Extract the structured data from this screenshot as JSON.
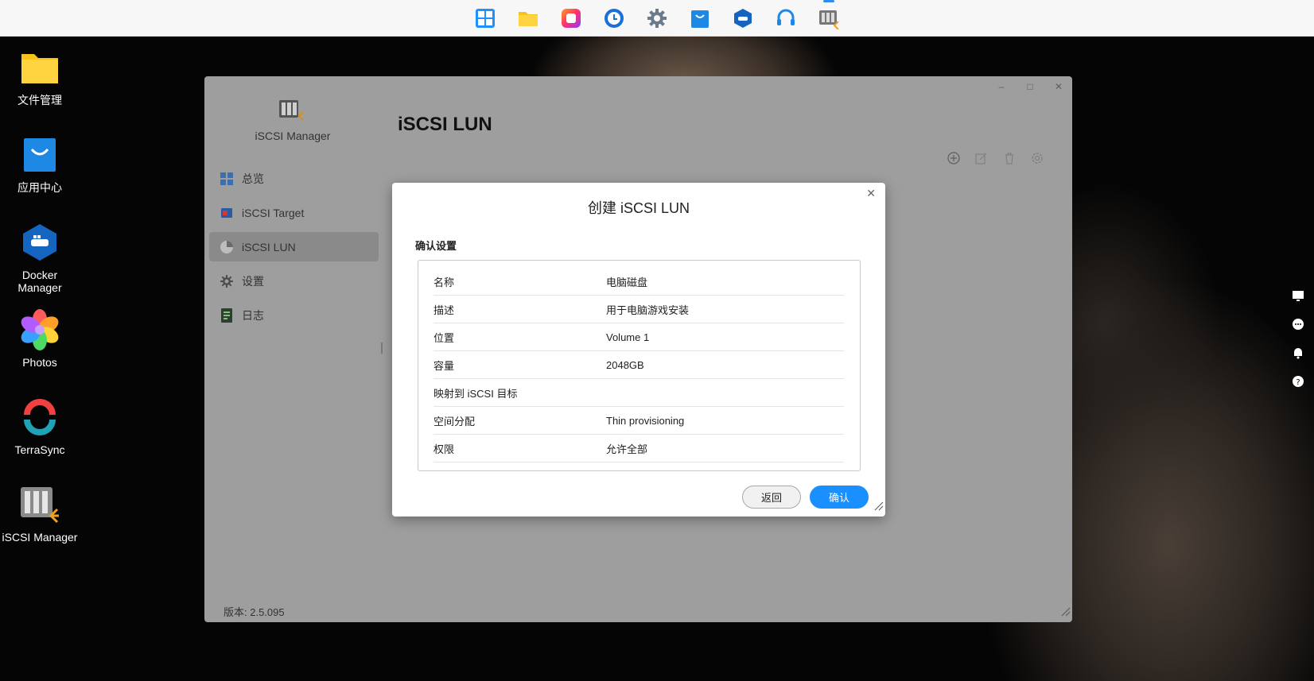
{
  "taskbar": {
    "icons": [
      "apps-grid-icon",
      "file-manager-icon",
      "photos-square-icon",
      "clock-icon",
      "settings-gear-icon",
      "app-store-bag-icon",
      "docker-icon",
      "headset-icon",
      "iscsi-manager-icon"
    ]
  },
  "desktop": {
    "items": [
      {
        "label": "文件管理",
        "icon": "folder-icon"
      },
      {
        "label": "应用中心",
        "icon": "shopping-bag-icon"
      },
      {
        "label": "Docker\nManager",
        "label1": "Docker",
        "label2": "Manager",
        "icon": "docker-icon"
      },
      {
        "label": "Photos",
        "icon": "flower-icon"
      },
      {
        "label": "TerraSync",
        "icon": "sync-icon"
      },
      {
        "label": "iSCSI Manager",
        "icon": "iscsi-manager-icon"
      }
    ]
  },
  "window": {
    "app_name": "iSCSI Manager",
    "page_title": "iSCSI LUN",
    "version": "版本: 2.5.095",
    "nav": [
      {
        "label": "总览",
        "icon": "overview-grid-icon"
      },
      {
        "label": "iSCSI Target",
        "icon": "target-icon"
      },
      {
        "label": "iSCSI LUN",
        "icon": "lun-disk-icon",
        "active": true
      },
      {
        "label": "设置",
        "icon": "gear-icon"
      },
      {
        "label": "日志",
        "icon": "log-icon"
      }
    ],
    "controls": {
      "minimize": "–",
      "maximize": "□",
      "close": "✕"
    }
  },
  "dialog": {
    "title": "创建 iSCSI LUN",
    "section": "确认设置",
    "close": "✕",
    "rows": [
      {
        "key": "名称",
        "value": "电脑磁盘"
      },
      {
        "key": "描述",
        "value": "用于电脑游戏安装"
      },
      {
        "key": "位置",
        "value": "Volume 1"
      },
      {
        "key": "容量",
        "value": "2048GB"
      },
      {
        "key": "映射到 iSCSI 目标",
        "value": ""
      },
      {
        "key": "空间分配",
        "value": "Thin provisioning"
      },
      {
        "key": "权限",
        "value": "允许全部"
      }
    ],
    "back_label": "返回",
    "confirm_label": "确认"
  },
  "colors": {
    "accent": "#1a8fff",
    "window_bg": "#9e9e9e",
    "taskbar_bg": "#f7f7f7"
  }
}
